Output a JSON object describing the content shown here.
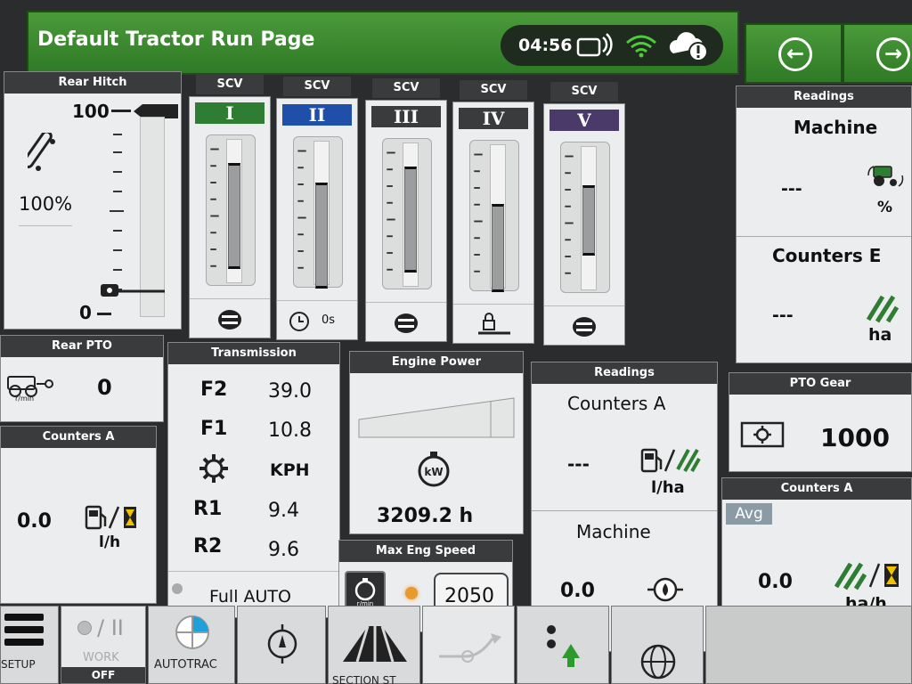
{
  "header": {
    "title": "Default Tractor Run Page",
    "clock": "04:56"
  },
  "rear_hitch": {
    "title": "Rear Hitch",
    "max": "100",
    "min": "0",
    "value": "100%"
  },
  "scv": {
    "label": "SCV",
    "items": [
      {
        "roman": "I",
        "color": "#2e7d32",
        "fill_top": 0.18,
        "fill_bottom": 0.88
      },
      {
        "roman": "II",
        "color": "#1f4fa8",
        "fill_top": 0.3,
        "fill_bottom": 1.0,
        "footer_text": "0s"
      },
      {
        "roman": "III",
        "color": "#3a3b3c",
        "fill_top": 0.18,
        "fill_bottom": 0.88
      },
      {
        "roman": "IV",
        "color": "#3a3b3c",
        "fill_top": 0.42,
        "fill_bottom": 1.0
      },
      {
        "roman": "V",
        "color": "#4a3a6a",
        "fill_top": 0.28,
        "fill_bottom": 0.75
      }
    ]
  },
  "rear_pto": {
    "title": "Rear PTO",
    "value": "0",
    "unit_label": "r/min"
  },
  "counters_a_left": {
    "title": "Counters A",
    "value": "0.0",
    "unit": "l/h"
  },
  "transmission": {
    "title": "Transmission",
    "rows": [
      {
        "label": "F2",
        "value": "39.0"
      },
      {
        "label": "F1",
        "value": "10.8"
      },
      {
        "label": "",
        "value": "KPH"
      },
      {
        "label": "R1",
        "value": "9.4"
      },
      {
        "label": "R2",
        "value": "9.6"
      }
    ],
    "mode": "Full AUTO"
  },
  "engine_power": {
    "title": "Engine Power",
    "value": "3209.2 h",
    "icon_text": "kW"
  },
  "max_eng_speed": {
    "title": "Max Eng Speed",
    "value": "2050"
  },
  "readings_mid": {
    "title": "Readings",
    "counters_a": "Counters A",
    "counters_value": "---",
    "counters_unit": "l/ha",
    "machine": "Machine",
    "machine_value": "0.0",
    "machine_unit": "bar"
  },
  "readings_right": {
    "title": "Readings",
    "machine": "Machine",
    "machine_value": "---",
    "machine_unit": "%",
    "counters_e": "Counters E",
    "counters_value": "---",
    "counters_unit": "ha"
  },
  "pto_gear": {
    "title": "PTO Gear",
    "value": "1000"
  },
  "counters_a_right": {
    "title": "Counters A",
    "avg": "Avg",
    "value": "0.0",
    "unit": "ha/h"
  },
  "tabs": {
    "setup": "SETUP",
    "work": "WORK",
    "work_state": "OFF",
    "autotrac": "AUTOTRAC",
    "section": "SECTION ST"
  },
  "colors": {
    "jd_green": "#367c2b",
    "panel": "#ecedee",
    "header": "#3a3b3c"
  }
}
